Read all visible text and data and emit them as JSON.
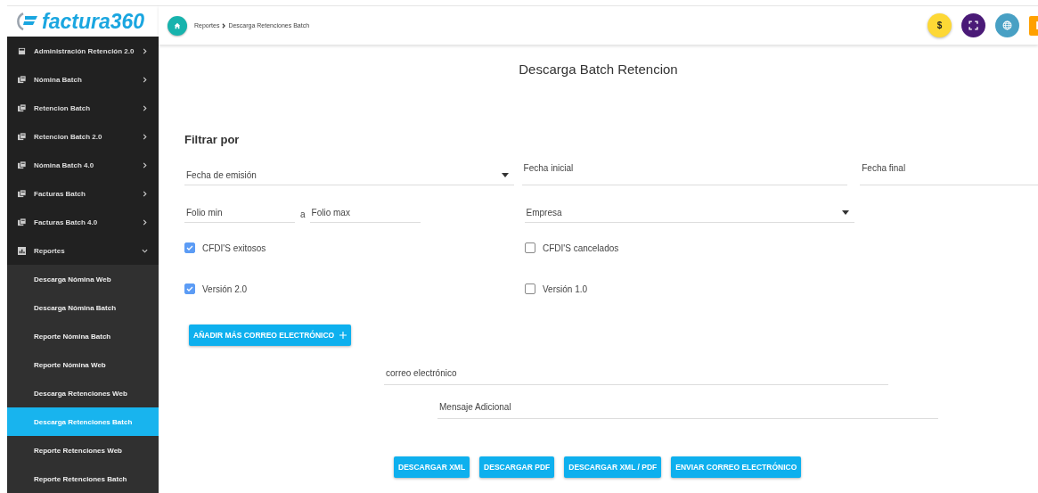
{
  "logo": {
    "text": "factura360"
  },
  "sidebar": {
    "items": [
      {
        "label": "Administración Retención 2.0",
        "kind": "calc",
        "expanded": false,
        "selected": false
      },
      {
        "label": "Nómina Batch",
        "kind": "docs",
        "expanded": false,
        "selected": false
      },
      {
        "label": "Retencion Batch",
        "kind": "docs",
        "expanded": false,
        "selected": false
      },
      {
        "label": "Retencion Batch 2.0",
        "kind": "docs",
        "expanded": false,
        "selected": false
      },
      {
        "label": "Nómina Batch 4.0",
        "kind": "docs",
        "expanded": false,
        "selected": false
      },
      {
        "label": "Facturas Batch",
        "kind": "docs",
        "expanded": false,
        "selected": false
      },
      {
        "label": "Facturas Batch 4.0",
        "kind": "docs",
        "expanded": false,
        "selected": false
      },
      {
        "label": "Reportes",
        "kind": "chart",
        "expanded": true,
        "selected": false,
        "children": [
          {
            "label": "Descarga Nómina Web",
            "selected": false
          },
          {
            "label": "Descarga Nómina Batch",
            "selected": false
          },
          {
            "label": "Reporte Nómina Batch",
            "selected": false
          },
          {
            "label": "Reporte Nómina Web",
            "selected": false
          },
          {
            "label": "Descarga Retenciones Web",
            "selected": false
          },
          {
            "label": "Descarga Retenciones Batch",
            "selected": true
          },
          {
            "label": "Reporte Retenciones Web",
            "selected": false
          },
          {
            "label": "Reporte Retenciones Batch",
            "selected": false
          }
        ]
      }
    ]
  },
  "breadcrumb": [
    "Reportes",
    "Descarga Retenciones Batch"
  ],
  "header_actions": [
    {
      "kind": "dollar",
      "label": "$"
    },
    {
      "kind": "fullscreen"
    },
    {
      "kind": "globe"
    },
    {
      "kind": "doc"
    }
  ],
  "page_title": "Descarga Batch Retencion",
  "filter_heading": "Filtrar por",
  "date_type": {
    "value": "Fecha de emisión"
  },
  "start_date": {
    "placeholder": "Fecha inicial"
  },
  "end_date": {
    "placeholder": "Fecha final"
  },
  "folio_min": {
    "placeholder": "Folio min"
  },
  "folio_separator": "a",
  "folio_max": {
    "placeholder": "Folio max"
  },
  "company": {
    "placeholder": "Empresa"
  },
  "checkboxes": [
    {
      "label": "CFDI'S exitosos",
      "checked": true
    },
    {
      "label": "CFDI'S cancelados",
      "checked": false
    },
    {
      "label": "Versión 2.0",
      "checked": true
    },
    {
      "label": "Versión 1.0",
      "checked": false
    }
  ],
  "add_email_button": "AÑADIR MÁS CORREO ELECTRÓNICO",
  "email": {
    "placeholder": "correo electrónico"
  },
  "message": {
    "placeholder": "Mensaje Adicional"
  },
  "actions": [
    "DESCARGAR XML",
    "DESCARGAR PDF",
    "DESCARGAR XML / PDF",
    "ENVIAR CORREO ELECTRÓNICO"
  ]
}
